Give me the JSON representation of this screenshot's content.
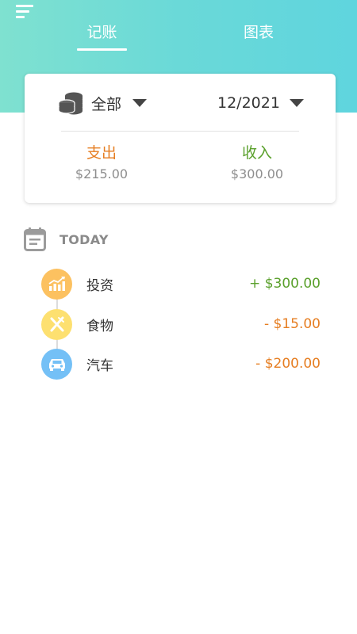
{
  "colors": {
    "header_gradient_start": "#7fe1d0",
    "header_gradient_end": "#5fd5de",
    "expense": "#e67e22",
    "income": "#5aa02c",
    "muted": "#8e8e8e"
  },
  "header": {
    "menu_icon": "menu-icon",
    "tabs": [
      {
        "label": "记账",
        "active": true
      },
      {
        "label": "图表",
        "active": false
      }
    ]
  },
  "summary": {
    "account_icon": "coins-icon",
    "account_filter": "全部",
    "date_filter": "12/2021",
    "expense": {
      "title": "支出",
      "amount": "$215.00"
    },
    "income": {
      "title": "收入",
      "amount": "$300.00"
    }
  },
  "today": {
    "icon": "calendar-icon",
    "label": "TODAY",
    "transactions": [
      {
        "name": "投资",
        "amount": "+ $300.00",
        "type": "income",
        "icon": "investment-chart-icon",
        "icon_color": "#fcc160"
      },
      {
        "name": "食物",
        "amount": "- $15.00",
        "type": "expense",
        "icon": "fork-knife-icon",
        "icon_color": "#fde070"
      },
      {
        "name": "汽车",
        "amount": "- $200.00",
        "type": "expense",
        "icon": "car-icon",
        "icon_color": "#74c0f6"
      }
    ]
  }
}
